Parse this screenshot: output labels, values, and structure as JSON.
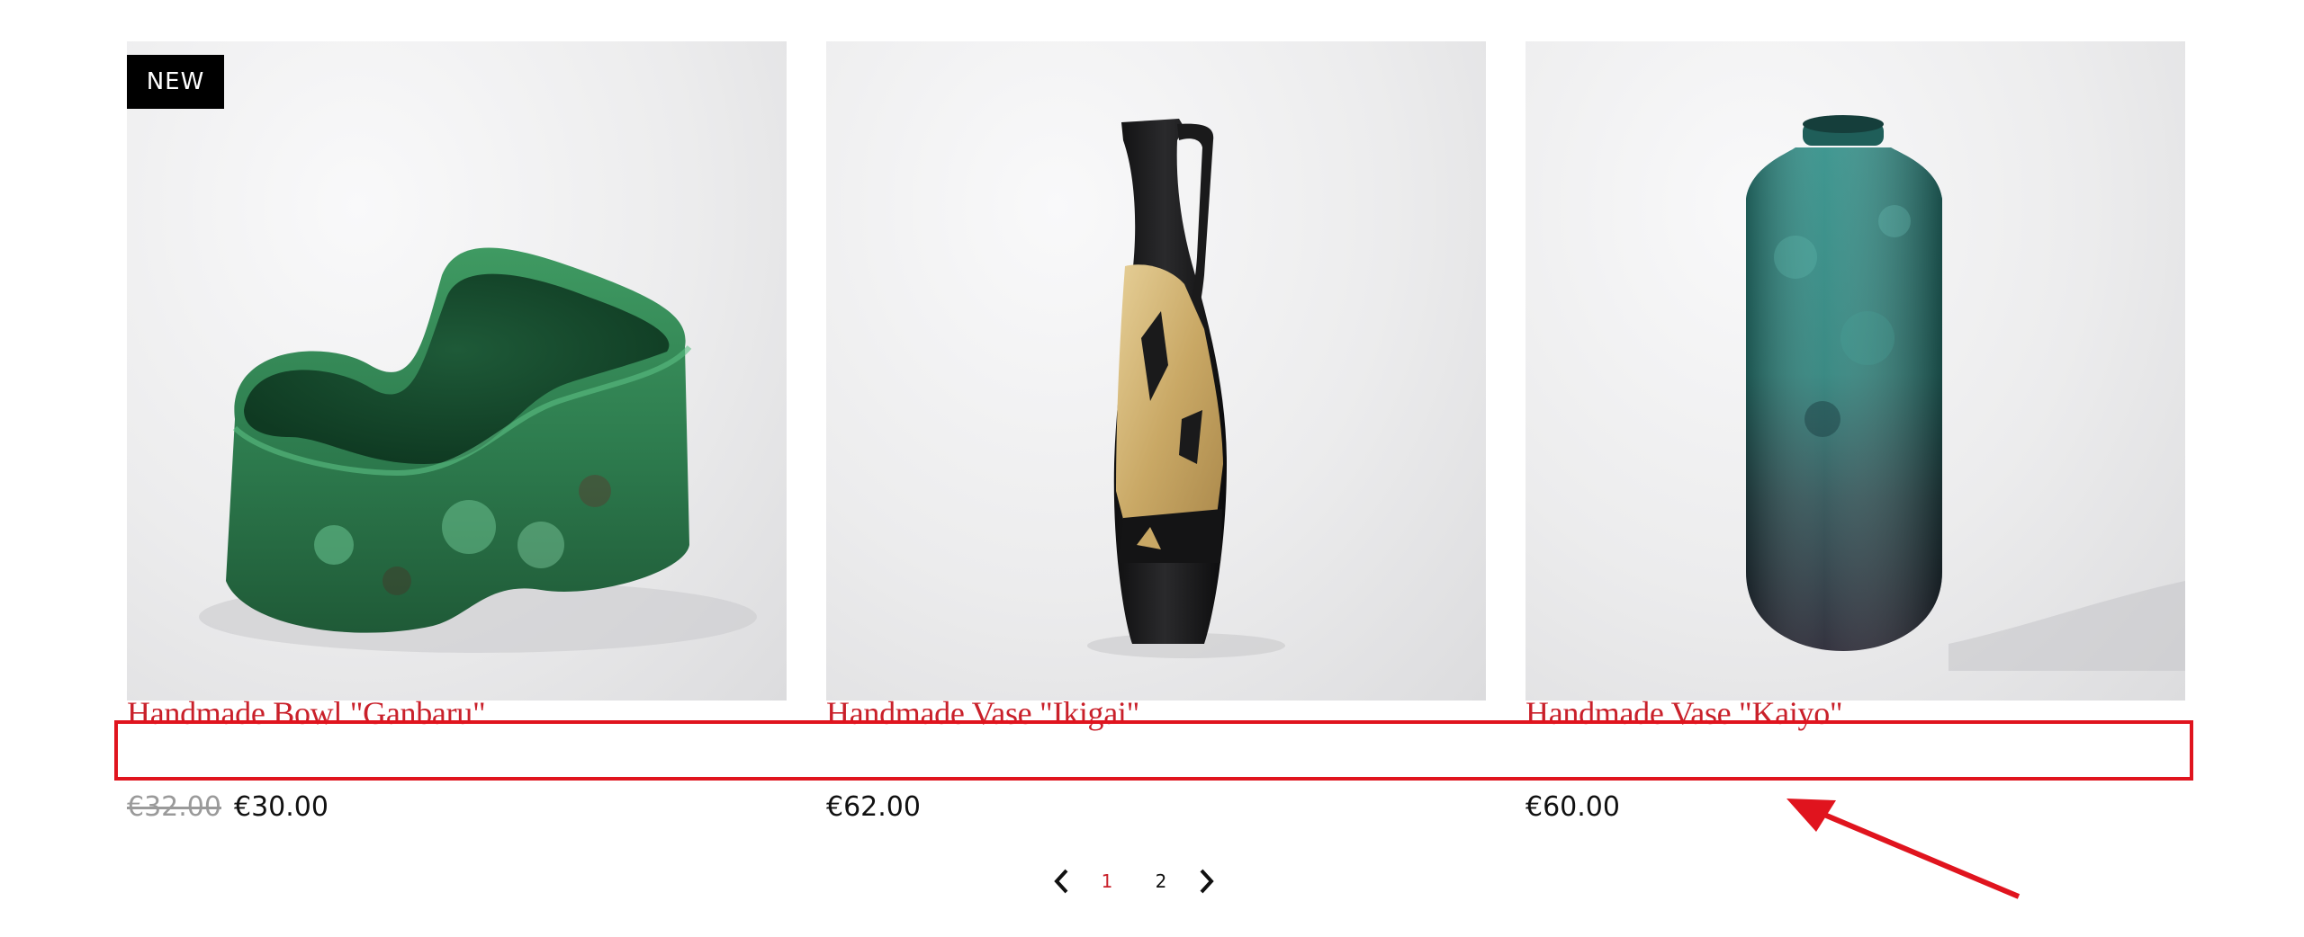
{
  "products": [
    {
      "title": "Handmade Bowl \"Ganbaru\"",
      "badge": "NEW",
      "old_price": "€32.00",
      "price": "€30.00",
      "image": "green-ceramic-bowl"
    },
    {
      "title": "Handmade Vase \"Ikigai\"",
      "price": "€62.00",
      "image": "black-gold-pitcher-vase"
    },
    {
      "title": "Handmade Vase \"Kaiyo\"",
      "price": "€60.00",
      "image": "teal-cylinder-vase"
    }
  ],
  "pagination": {
    "prev_icon": "chevron-left-icon",
    "pages": [
      "1",
      "2"
    ],
    "current": "1",
    "next_icon": "chevron-right-icon"
  },
  "colors": {
    "title_red": "#c9202a",
    "annotation_red": "#e0141e",
    "badge_bg": "#000000"
  }
}
